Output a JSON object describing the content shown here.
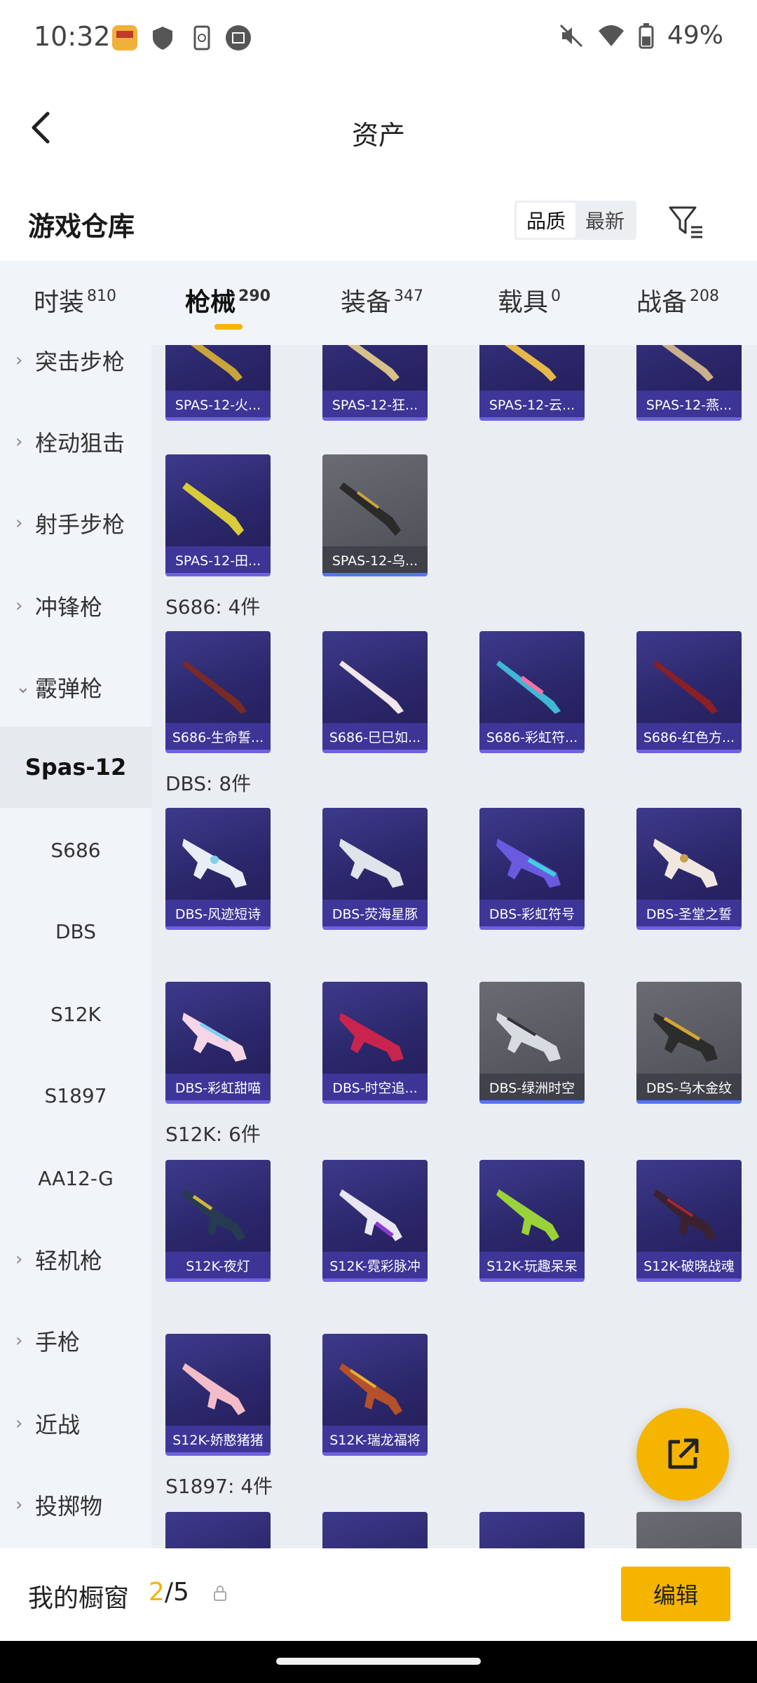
{
  "status": {
    "time": "10:32",
    "battery": "49%"
  },
  "header": {
    "title": "资产"
  },
  "warehouse": {
    "title": "游戏仓库",
    "sort_quality": "品质",
    "sort_latest": "最新"
  },
  "tabs": [
    {
      "label": "时装",
      "count": "810"
    },
    {
      "label": "枪械",
      "count": "290"
    },
    {
      "label": "装备",
      "count": "347"
    },
    {
      "label": "载具",
      "count": "0"
    },
    {
      "label": "战备",
      "count": "208"
    }
  ],
  "sidebar": {
    "items": [
      {
        "label": "突击步枪"
      },
      {
        "label": "栓动狙击"
      },
      {
        "label": "射手步枪"
      },
      {
        "label": "冲锋枪"
      },
      {
        "label": "霰弹枪"
      },
      {
        "label": "Spas-12"
      },
      {
        "label": "S686"
      },
      {
        "label": "DBS"
      },
      {
        "label": "S12K"
      },
      {
        "label": "S1897"
      },
      {
        "label": "AA12-G"
      },
      {
        "label": "轻机枪"
      },
      {
        "label": "手枪"
      },
      {
        "label": "近战"
      },
      {
        "label": "投掷物"
      }
    ]
  },
  "sections": {
    "s686": "S686: 4件",
    "dbs": "DBS: 8件",
    "s12k": "S12K: 6件",
    "s1897": "S1897: 4件"
  },
  "cards": {
    "spas_top": [
      "SPAS-12-火...",
      "SPAS-12-狂...",
      "SPAS-12-云...",
      "SPAS-12-燕..."
    ],
    "spas_row2": [
      "SPAS-12-田...",
      "SPAS-12-乌..."
    ],
    "s686": [
      "S686-生命誓...",
      "S686-巳巳如...",
      "S686-彩虹符...",
      "S686-红色方..."
    ],
    "dbs_row1": [
      "DBS-风迹短诗",
      "DBS-荧海星豚",
      "DBS-彩虹符号",
      "DBS-圣堂之誓"
    ],
    "dbs_row2": [
      "DBS-彩虹甜喵",
      "DBS-时空追...",
      "DBS-绿洲时空",
      "DBS-乌木金纹"
    ],
    "s12k_row1": [
      "S12K-夜灯",
      "S12K-霓彩脉冲",
      "S12K-玩趣呆呆",
      "S12K-破晓战魂"
    ],
    "s12k_row2": [
      "S12K-娇憨猪猪",
      "S12K-瑞龙福将"
    ]
  },
  "bottom": {
    "window_label": "我的橱窗",
    "window_current": "2",
    "window_total": "/5",
    "edit_label": "编辑"
  },
  "colors": {
    "accent": "#f5b400",
    "card_purple": "#2a2669",
    "card_gray": "#55555d"
  }
}
